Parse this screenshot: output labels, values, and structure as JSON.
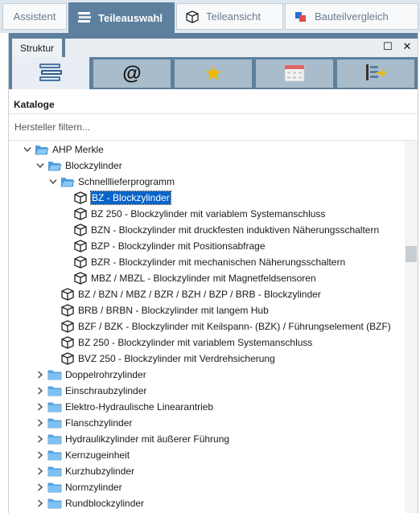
{
  "top_tabs": [
    {
      "label": "Assistent"
    },
    {
      "label": "Teileauswahl"
    },
    {
      "label": "Teileansicht"
    },
    {
      "label": "Bauteilvergleich"
    }
  ],
  "panel": {
    "title": "Struktur",
    "maximize_glyph": "☐",
    "close_glyph": "✕",
    "icon_buttons": [
      {
        "icon": "catalog-books-icon"
      },
      {
        "icon": "at-sign-icon",
        "glyph": "@"
      },
      {
        "icon": "star-icon",
        "glyph": "★"
      },
      {
        "icon": "calendar-icon"
      },
      {
        "icon": "export-icon"
      }
    ],
    "section_label": "Kataloge",
    "filter_placeholder": "Hersteller filtern..."
  },
  "tree": {
    "manufacturer": "AHP Merkle",
    "group": "Blockzylinder",
    "subgroup": "Schnelllieferprogramm",
    "subgroup_items": [
      "BZ - Blockzylinder",
      "BZ 250 - Blockzylinder mit variablem Systemanschluss",
      "BZN - Blockzylinder mit druckfesten induktiven Näherungsschaltern",
      "BZP - Blockzylinder mit Positionsabfrage",
      "BZR - Blockzylinder mit mechanischen Näherungsschaltern",
      "MBZ / MBZL - Blockzylinder mit Magnetfeldsensoren"
    ],
    "group_items": [
      "BZ / BZN / MBZ / BZR / BZH / BZP / BRB - Blockzylinder",
      "BRB / BRBN - Blockzylinder mit langem Hub",
      "BZF / BZK - Blockzylinder mit Keilspann- (BZK) / Führungselement (BZF)",
      "BZ 250 - Blockzylinder mit variablem Systemanschluss",
      "BVZ 250 - Blockzylinder mit Verdrehsicherung"
    ],
    "folders": [
      "Doppelrohrzylinder",
      "Einschraubzylinder",
      "Elektro-Hydraulische Linearantrieb",
      "Flanschzylinder",
      "Hydraulikzylinder mit äußerer Führung",
      "Kernzugeinheit",
      "Kurzhubzylinder",
      "Normzylinder",
      "Rundblockzylinder"
    ]
  }
}
